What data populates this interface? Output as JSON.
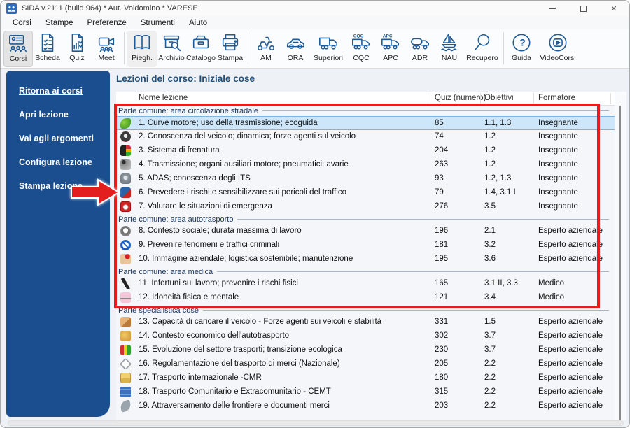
{
  "colors": {
    "accent_blue": "#1e5a96",
    "sidebar_bg": "#1a4e8e",
    "selection_bg": "#cde6f9",
    "annotation_red": "#e31e1e",
    "navy_text": "#17365d"
  },
  "window": {
    "title": "SIDA v.2111 (build 964) * Aut. Voldomino * VARESE"
  },
  "menu": {
    "items": [
      "Corsi",
      "Stampe",
      "Preferenze",
      "Strumenti",
      "Aiuto"
    ]
  },
  "toolbar": {
    "groups": [
      {
        "buttons": [
          {
            "label": "Corsi",
            "icon": "courses",
            "selected": true
          },
          {
            "label": "Scheda",
            "icon": "sheet"
          },
          {
            "label": "Quiz",
            "icon": "quiz"
          },
          {
            "label": "Meet",
            "icon": "meet"
          }
        ]
      },
      {
        "buttons": [
          {
            "label": "Piegh.",
            "icon": "leaflet",
            "highlighted": true
          },
          {
            "label": "Archivio",
            "icon": "archive"
          },
          {
            "label": "Catalogo",
            "icon": "catalog"
          },
          {
            "label": "Stampa",
            "icon": "print"
          }
        ]
      },
      {
        "buttons": [
          {
            "label": "AM",
            "icon": "scooter"
          },
          {
            "label": "ORA",
            "icon": "car"
          },
          {
            "label": "Superiori",
            "icon": "truck",
            "wide": true
          },
          {
            "label": "CQC",
            "icon": "truck-cqc"
          },
          {
            "label": "APC",
            "icon": "truck-apc"
          },
          {
            "label": "ADR",
            "icon": "tanker"
          },
          {
            "label": "NAU",
            "icon": "sailboat"
          },
          {
            "label": "Recupero",
            "icon": "magnifier",
            "wide": true
          }
        ]
      },
      {
        "buttons": [
          {
            "label": "Guida",
            "icon": "help"
          },
          {
            "label": "VideoCorsi",
            "icon": "video",
            "xwide": true
          }
        ]
      }
    ]
  },
  "sidebar": {
    "items": [
      {
        "label": "Ritorna ai corsi",
        "underlined": true
      },
      {
        "label": "Apri lezione"
      },
      {
        "label": "Vai agli argomenti"
      },
      {
        "label": "Configura lezione"
      },
      {
        "label": "Stampa lezione"
      }
    ]
  },
  "main": {
    "title": "Lezioni del corso: Iniziale cose",
    "table": {
      "columns": [
        "Nome lezione",
        "Quiz (numero)",
        "Obiettivi",
        "Formatore"
      ],
      "rows": [
        {
          "type": "group",
          "label": "Parte comune: area circolazione stradale"
        },
        {
          "type": "lesson",
          "icon": "eco-leaves",
          "name": "1. Curve motore; uso della trasmissione; ecoguida",
          "quiz": "85",
          "obiettivi": "1.1, 1.3",
          "formatore": "Insegnante",
          "selected": true
        },
        {
          "type": "lesson",
          "icon": "speedometer",
          "name": "2. Conoscenza del veicolo; dinamica; forze agenti sul veicolo",
          "quiz": "74",
          "obiettivi": "1.2",
          "formatore": "Insegnante"
        },
        {
          "type": "lesson",
          "icon": "tire-traffic-light",
          "name": "3. Sistema di frenatura",
          "quiz": "204",
          "obiettivi": "1.2",
          "formatore": "Insegnante"
        },
        {
          "type": "lesson",
          "icon": "gear-shift",
          "name": "4. Trasmissione; organi ausiliari motore; pneumatici; avarie",
          "quiz": "263",
          "obiettivi": "1.2",
          "formatore": "Insegnante"
        },
        {
          "type": "lesson",
          "icon": "adas-sensor",
          "name": "5. ADAS; conoscenza degli ITS",
          "quiz": "93",
          "obiettivi": "1.2, 1.3",
          "formatore": "Insegnante"
        },
        {
          "type": "lesson",
          "icon": "truck-risk",
          "name": "6. Prevedere i rischi e sensibilizzare sui pericoli del traffico",
          "quiz": "79",
          "obiettivi": "1.4, 3.1 I",
          "formatore": "Insegnante"
        },
        {
          "type": "lesson",
          "icon": "emergency-kit",
          "name": "7. Valutare le situazioni di emergenza",
          "quiz": "276",
          "obiettivi": "3.5",
          "formatore": "Insegnante"
        },
        {
          "type": "group",
          "label": "Parte comune: area autotrasporto"
        },
        {
          "type": "lesson",
          "icon": "work-clock",
          "name": "8. Contesto sociale; durata massima di lavoro",
          "quiz": "196",
          "obiettivi": "2.1",
          "formatore": "Esperto aziendale"
        },
        {
          "type": "lesson",
          "icon": "no-entry",
          "name": "9. Prevenire fenomeni e traffici criminali",
          "quiz": "181",
          "obiettivi": "3.2",
          "formatore": "Esperto aziendale"
        },
        {
          "type": "lesson",
          "icon": "hand-heart",
          "name": "10. Immagine aziendale; logistica sostenibile; manutenzione",
          "quiz": "195",
          "obiettivi": "3.6",
          "formatore": "Esperto aziendale"
        },
        {
          "type": "group",
          "label": "Parte comune: area medica"
        },
        {
          "type": "lesson",
          "icon": "falling-person",
          "name": "11. Infortuni sul lavoro; prevenire i rischi fisici",
          "quiz": "165",
          "obiettivi": "3.1 II, 3.3",
          "formatore": "Medico"
        },
        {
          "type": "lesson",
          "icon": "medical-certificate",
          "name": "12. Idoneità fisica e mentale",
          "quiz": "121",
          "obiettivi": "3.4",
          "formatore": "Medico"
        },
        {
          "type": "group",
          "label": "Parte specialistica cose"
        },
        {
          "type": "lesson",
          "icon": "cargo-box",
          "name": "13. Capacità di caricare il veicolo - Forze agenti sui veicoli e stabilità",
          "quiz": "331",
          "obiettivi": "1.5",
          "formatore": "Esperto aziendale"
        },
        {
          "type": "lesson",
          "icon": "economy-context",
          "name": "14. Contesto economico dell'autotrasporto",
          "quiz": "302",
          "obiettivi": "3.7",
          "formatore": "Esperto aziendale"
        },
        {
          "type": "lesson",
          "icon": "ecology-pencils",
          "name": "15. Evoluzione del settore trasporti; transizione ecologica",
          "quiz": "230",
          "obiettivi": "3.7",
          "formatore": "Esperto aziendale"
        },
        {
          "type": "lesson",
          "icon": "diamond-document",
          "name": "16. Regolamentazione del trasporto di merci (Nazionale)",
          "quiz": "205",
          "obiettivi": "2.2",
          "formatore": "Esperto aziendale"
        },
        {
          "type": "lesson",
          "icon": "folder-cmr",
          "name": "17. Trasporto internazionale -CMR",
          "quiz": "180",
          "obiettivi": "2.2",
          "formatore": "Esperto aziendale"
        },
        {
          "type": "lesson",
          "icon": "blue-book",
          "name": "18. Trasporto Comunitario e Extracomunitario - CEMT",
          "quiz": "315",
          "obiettivi": "2.2",
          "formatore": "Esperto aziendale"
        },
        {
          "type": "lesson",
          "icon": "dove-bird",
          "name": "19. Attraversamento delle frontiere e documenti merci",
          "quiz": "203",
          "obiettivi": "2.2",
          "formatore": "Esperto aziendale"
        }
      ]
    }
  }
}
